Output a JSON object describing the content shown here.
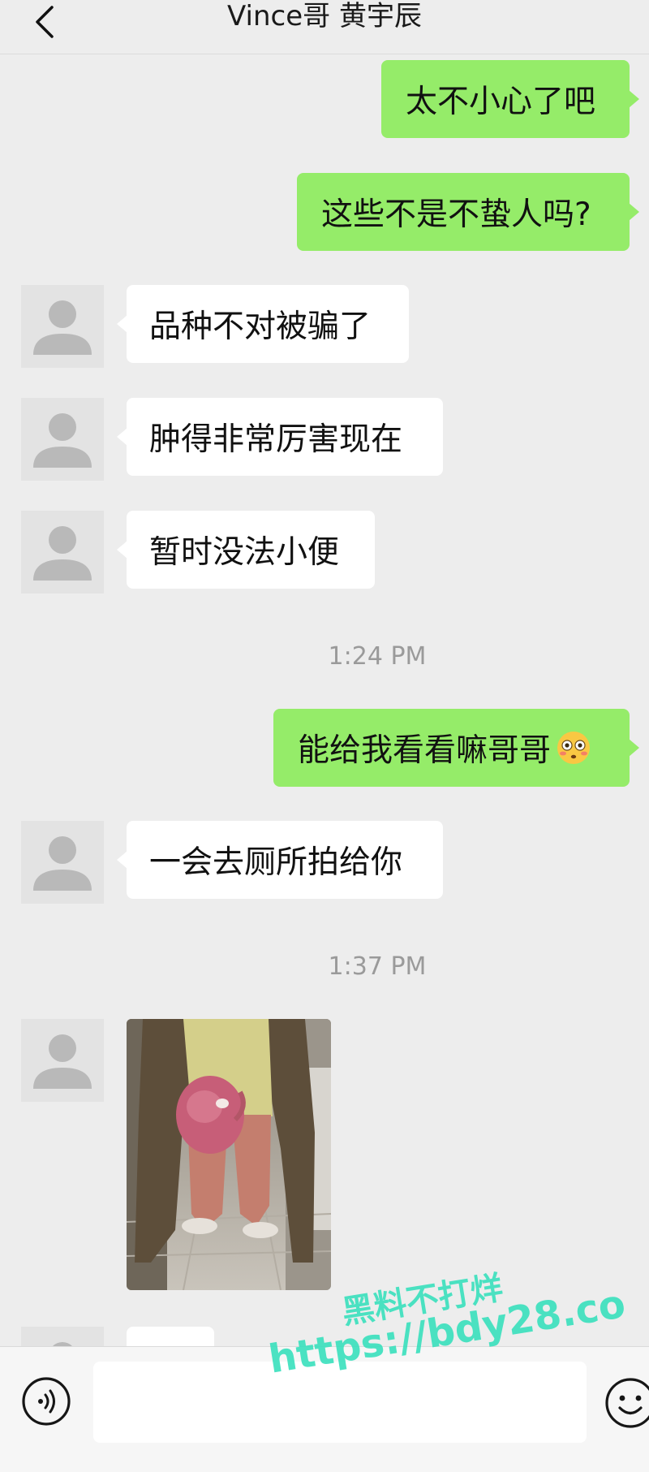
{
  "header": {
    "title": "Vince哥 黄宇辰"
  },
  "messages": [
    {
      "type": "sent",
      "text": "太不小心了吧"
    },
    {
      "type": "sent",
      "text": "这些不是不蛰人吗?"
    },
    {
      "type": "received",
      "text": "品种不对被骗了"
    },
    {
      "type": "received",
      "text": "肿得非常厉害现在"
    },
    {
      "type": "received",
      "text": "暂时没法小便"
    },
    {
      "type": "timestamp",
      "text": "1:24 PM"
    },
    {
      "type": "sent",
      "text": "能给我看看嘛哥哥",
      "emoji": "flushed-face"
    },
    {
      "type": "received",
      "text": "一会去厕所拍给你"
    },
    {
      "type": "timestamp",
      "text": "1:37 PM"
    },
    {
      "type": "received-image",
      "text": ""
    }
  ],
  "watermark": {
    "line1": "黑料不打烊",
    "line2": "https://bdy28.co"
  },
  "input_bar": {
    "value": "",
    "placeholder": ""
  },
  "icons": {
    "back": "chevron-left-icon",
    "voice": "voice-icon",
    "emoji": "emoji-icon",
    "avatar": "default-avatar-icon"
  },
  "colors": {
    "background": "#ededed",
    "sent_bubble": "#95ec69",
    "received_bubble": "#ffffff",
    "watermark": "#39e0bd"
  }
}
